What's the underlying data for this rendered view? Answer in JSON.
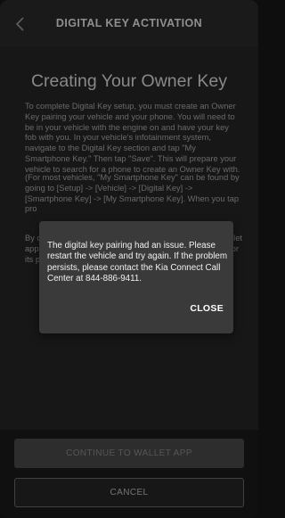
{
  "header": {
    "title": "DIGITAL KEY ACTIVATION",
    "back_icon": "chevron-left-icon"
  },
  "main": {
    "title": "Creating Your Owner Key",
    "paragraph_1": "To complete Digital Key setup, you must create an Owner Key pairing your vehicle and your phone. You will need to be in your vehicle with the engine on and have your key fob with you. In your vehicle's infotainment system, navigate to the Digital Key section and tap \"My Smartphone Key.\" Then tap \"Save\". This will prepare your vehicle to search for a phone to create an Owner Key with.",
    "paragraph_2": "(For most vehicles, \"My Smartphone Key\" can be found by going to [Setup] -> [Vehicle] -> [Digital Key] -> [Smartphone Key] -> [My Smartphone Key]. When you tap",
    "paragraph_2_tail": "pro",
    "paragraph_3_head": "By c",
    "paragraph_3_lines": [
      "app",
      "its p"
    ],
    "paragraph_3_right": [
      "llet",
      "or"
    ]
  },
  "dialog": {
    "message": "The digital key pairing had an issue. Please restart the vehicle and try again. If the problem persists, please contact the Kia Connect Call Center at 844-886-9411.",
    "close_label": "CLOSE"
  },
  "buttons": {
    "continue_label": "CONTINUE TO WALLET APP",
    "cancel_label": "CANCEL"
  },
  "colors": {
    "background": "#1a1a1a",
    "header": "#2b2b2b",
    "dialog": "#3a3a3a",
    "continue_button": "#4a4a4a"
  }
}
